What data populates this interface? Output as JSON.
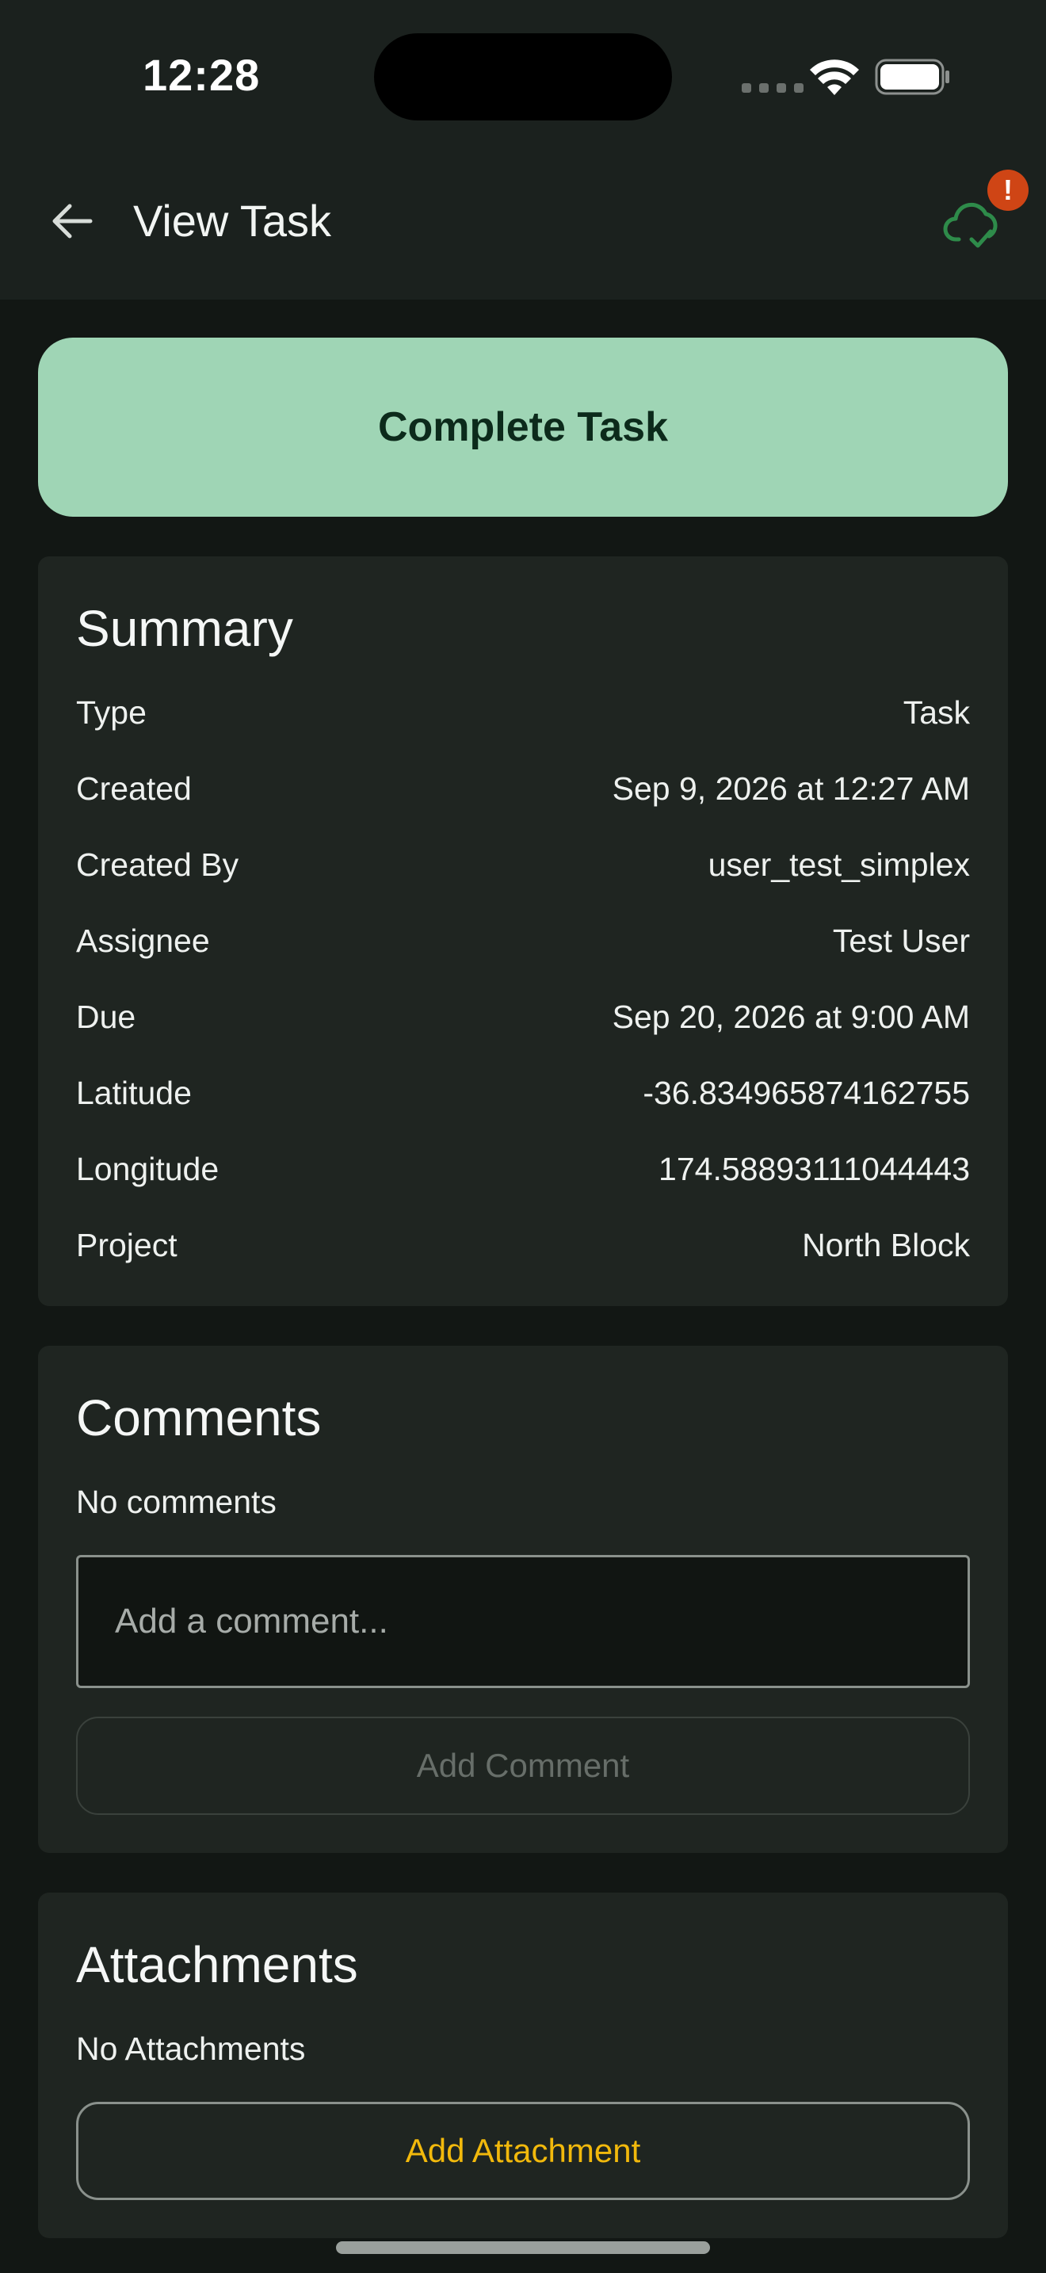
{
  "status_bar": {
    "time": "12:28"
  },
  "header": {
    "title": "View Task",
    "sync_badge": "!"
  },
  "actions": {
    "complete_label": "Complete Task"
  },
  "summary": {
    "title": "Summary",
    "rows": [
      {
        "label": "Type",
        "value": "Task"
      },
      {
        "label": "Created",
        "value": "Sep 9, 2026 at 12:27 AM"
      },
      {
        "label": "Created By",
        "value": "user_test_simplex"
      },
      {
        "label": "Assignee",
        "value": "Test User"
      },
      {
        "label": "Due",
        "value": "Sep 20, 2026 at 9:00 AM"
      },
      {
        "label": "Latitude",
        "value": "-36.834965874162755"
      },
      {
        "label": "Longitude",
        "value": "174.58893111044443"
      },
      {
        "label": "Project",
        "value": "North Block"
      }
    ]
  },
  "comments": {
    "title": "Comments",
    "empty_text": "No comments",
    "input_placeholder": "Add a comment...",
    "input_value": "",
    "add_button_label": "Add Comment"
  },
  "attachments": {
    "title": "Attachments",
    "empty_text": "No Attachments",
    "add_button_label": "Add Attachment"
  },
  "colors": {
    "background": "#121714",
    "bar": "#1b211e",
    "card": "#1f2521",
    "primary_button": "#9fd5b5",
    "accent_yellow": "#f2b90c",
    "sync_green": "#2e8b4a",
    "alert_red": "#cf4515"
  },
  "icons": {
    "back": "arrow-left-icon",
    "sync": "cloud-check-icon",
    "wifi": "wifi-icon",
    "battery": "battery-icon"
  }
}
